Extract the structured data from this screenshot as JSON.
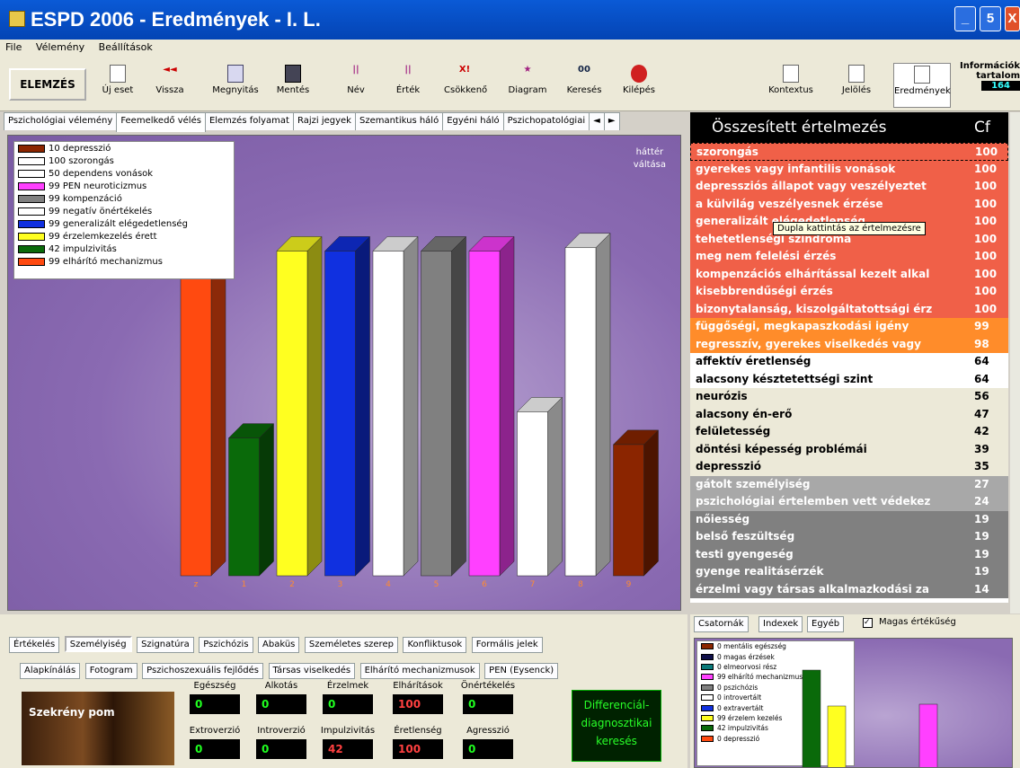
{
  "window": {
    "title": "ESPD 2006 - Eredmények - I. L.",
    "buttons": [
      "_",
      "5",
      "X"
    ]
  },
  "menu": [
    "File",
    "Vélemény",
    "Beállítások"
  ],
  "toolbar": {
    "elemzes": "ELEMZÉS",
    "items": [
      "Új eset",
      "Vissza",
      "Megnyitás",
      "Mentés",
      "Név",
      "Érték",
      "Csökkenő",
      "Diagram",
      "Keresés",
      "Kilépés"
    ],
    "right_items": [
      "Kontextus",
      "Jelölés",
      "Eredmények"
    ],
    "info_title": "Információk",
    "info_sub": "tartalom",
    "info_value": "164"
  },
  "tabs": [
    "Pszichológiai vélemény",
    "Feemelkedő vélés",
    "Elemzés folyamat",
    "Rajzi jegyek",
    "Szemantikus háló",
    "Egyéni háló",
    "Pszichopatológiai"
  ],
  "tabs_scroll": [
    "◄",
    "►"
  ],
  "chart_data": {
    "type": "bar",
    "legend": [
      {
        "label": "10 depresszió",
        "color": "#8b2500"
      },
      {
        "label": "100 szorongás",
        "color": "#ffffff"
      },
      {
        "label": "50 dependens vonások",
        "color": "#ffffff"
      },
      {
        "label": "99 PEN neuroticizmus",
        "color": "#ff40ff"
      },
      {
        "label": "99 kompenzáció",
        "color": "#808080"
      },
      {
        "label": "99 negatív önértékelés",
        "color": "#ffffff"
      },
      {
        "label": "99 generalizált elégedetlenség",
        "color": "#1030e0"
      },
      {
        "label": "99 érzelemkezelés érett",
        "color": "#ffff20"
      },
      {
        "label": "42 impulzivitás",
        "color": "#0a6a0a"
      },
      {
        "label": "99 elhárító mechanizmus",
        "color": "#ff4a10"
      }
    ],
    "categories": [
      "z",
      "1",
      "2",
      "3",
      "4",
      "5",
      "6",
      "7",
      "8",
      "9"
    ],
    "values": [
      98,
      42,
      99,
      99,
      99,
      99,
      99,
      50,
      100,
      40
    ],
    "colors": [
      "#ff4a10",
      "#0a6a0a",
      "#ffff20",
      "#1030e0",
      "#ffffff",
      "#808080",
      "#ff40ff",
      "#ffffff",
      "#ffffff",
      "#8b2500"
    ],
    "ylim": [
      0,
      115
    ]
  },
  "chart_corner": [
    "háttér",
    "váltása"
  ],
  "summary": {
    "header": "Összesített értelmezés",
    "header_cf": "Cf",
    "rows": [
      {
        "label": "szorongás",
        "cf": "100",
        "bg": "#f06048",
        "fg": "#ffffff"
      },
      {
        "label": "gyerekes vagy infantilis vonások",
        "cf": "100",
        "bg": "#f06048",
        "fg": "#ffffff"
      },
      {
        "label": "depressziós állapot vagy veszélyeztet",
        "cf": "100",
        "bg": "#f06048",
        "fg": "#ffffff"
      },
      {
        "label": "a külvilág veszélyesnek érzése",
        "cf": "100",
        "bg": "#f06048",
        "fg": "#ffffff"
      },
      {
        "label": "generalizált elégedetlenség",
        "cf": "100",
        "bg": "#f06048",
        "fg": "#ffffff"
      },
      {
        "label": "tehetetlenségi szindróma",
        "cf": "100",
        "bg": "#f06048",
        "fg": "#ffffff"
      },
      {
        "label": "meg nem felelési érzés",
        "cf": "100",
        "bg": "#f06048",
        "fg": "#ffffff"
      },
      {
        "label": "kompenzációs elhárítással kezelt alkal",
        "cf": "100",
        "bg": "#f06048",
        "fg": "#ffffff"
      },
      {
        "label": "kisebbrendűségi érzés",
        "cf": "100",
        "bg": "#f06048",
        "fg": "#ffffff"
      },
      {
        "label": "bizonytalanság, kiszolgáltatottsági érz",
        "cf": "100",
        "bg": "#f06048",
        "fg": "#ffffff"
      },
      {
        "label": "függőségi, megkapaszkodási igény",
        "cf": "99",
        "bg": "#ff8c2a",
        "fg": "#ffffff"
      },
      {
        "label": "regresszív, gyerekes viselkedés vagy",
        "cf": "98",
        "bg": "#ff8c2a",
        "fg": "#ffffff"
      },
      {
        "label": "affektív éretlenség",
        "cf": "64",
        "bg": "#ffffff",
        "fg": "#000000"
      },
      {
        "label": "alacsony késztetettségi szint",
        "cf": "64",
        "bg": "#ffffff",
        "fg": "#000000"
      },
      {
        "label": "neurózis",
        "cf": "56",
        "bg": "#ece9d8",
        "fg": "#000000"
      },
      {
        "label": "alacsony én-erő",
        "cf": "47",
        "bg": "#ece9d8",
        "fg": "#000000"
      },
      {
        "label": "felületesség",
        "cf": "42",
        "bg": "#ece9d8",
        "fg": "#000000"
      },
      {
        "label": "döntési képesség problémái",
        "cf": "39",
        "bg": "#ece9d8",
        "fg": "#000000"
      },
      {
        "label": "depresszió",
        "cf": "35",
        "bg": "#ece9d8",
        "fg": "#000000"
      },
      {
        "label": "gátolt személyiség",
        "cf": "27",
        "bg": "#a8a8a8",
        "fg": "#ffffff"
      },
      {
        "label": "pszichológiai értelemben vett védekez",
        "cf": "24",
        "bg": "#a8a8a8",
        "fg": "#ffffff"
      },
      {
        "label": "nőiesség",
        "cf": "19",
        "bg": "#808080",
        "fg": "#ffffff"
      },
      {
        "label": "belső feszültség",
        "cf": "19",
        "bg": "#808080",
        "fg": "#ffffff"
      },
      {
        "label": "testi gyengeség",
        "cf": "19",
        "bg": "#808080",
        "fg": "#ffffff"
      },
      {
        "label": "gyenge realitásérzék",
        "cf": "19",
        "bg": "#808080",
        "fg": "#ffffff"
      },
      {
        "label": "érzelmi vagy társas alkalmazkodási za",
        "cf": "14",
        "bg": "#808080",
        "fg": "#ffffff"
      }
    ]
  },
  "tooltip": "Dupla kattintás az értelmezésre",
  "bottom": {
    "tabs_row1": [
      "Értékelés",
      "Személyiség",
      "Szignatúra",
      "Pszichózis",
      "Abaküs",
      "Személetes szerep",
      "Konfliktusok",
      "Formális jelek"
    ],
    "tabs_row2": [
      "Alapkínálás",
      "Fotogram",
      "Pszichoszexuális fejlődés",
      "Társas viselkedés",
      "Elhárító mechanizmusok",
      "PEN (Eysenck)"
    ],
    "photo_caption": "Szekrény pom",
    "metrics_row1": [
      {
        "label": "Egészség",
        "value": "0",
        "red": false
      },
      {
        "label": "Alkotás",
        "value": "0",
        "red": false
      },
      {
        "label": "Érzelmek",
        "value": "0",
        "red": false
      },
      {
        "label": "Elhárítások",
        "value": "100",
        "red": true
      },
      {
        "label": "Önértékelés",
        "value": "0",
        "red": false
      }
    ],
    "metrics_row2": [
      {
        "label": "Extroverzió",
        "value": "0",
        "red": false
      },
      {
        "label": "Introverzió",
        "value": "0",
        "red": false
      },
      {
        "label": "Impulzivitás",
        "value": "42",
        "red": true
      },
      {
        "label": "Éretlenség",
        "value": "100",
        "red": true
      },
      {
        "label": "Agresszió",
        "value": "0",
        "red": false
      }
    ],
    "diff": "Differenciál-diagnosztikai keresés"
  },
  "bottom_right": {
    "tabs": [
      "Csatornák",
      "Indexek",
      "Egyéb"
    ],
    "check_label": "Magas értékűség",
    "mini_legend": [
      "0 mentális egészség",
      "0 magas érzések",
      "0 elmeorvosi rész",
      "99 elhárító mechanizmusok",
      "0 pszichózis",
      "0 introvertált",
      "0 extravertált",
      "99 érzelem kezelés",
      "42 impulzivitás",
      "0 depresszió"
    ],
    "mini_colors": [
      "#8b2500",
      "#10104a",
      "#0a7a7a",
      "#ff40ff",
      "#808080",
      "#ffffff",
      "#1030e0",
      "#ffff20",
      "#0a6a0a",
      "#ff4a10"
    ]
  }
}
